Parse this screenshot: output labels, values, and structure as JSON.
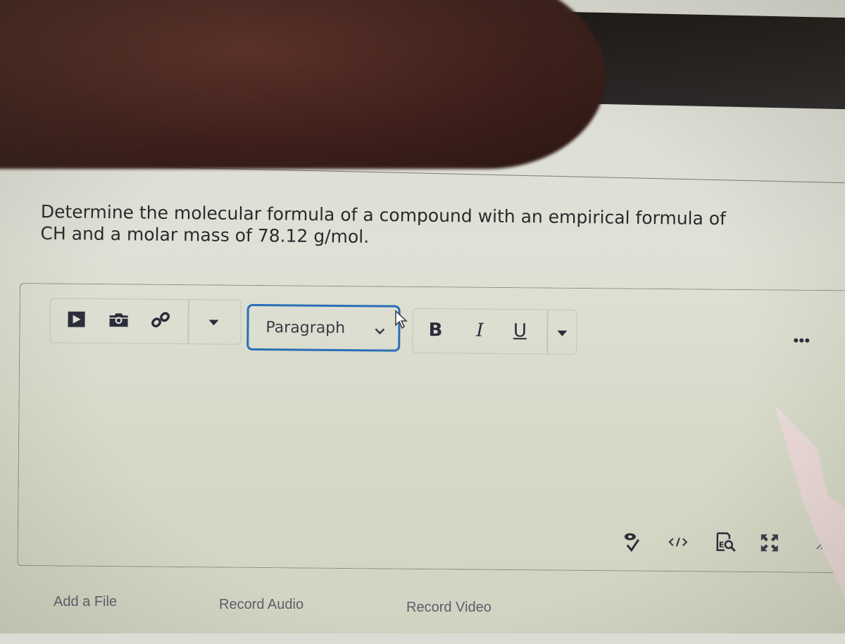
{
  "question": {
    "line1": "Determine the molecular formula of a compound with an empirical formula of",
    "line2": "CH and a molar mass of 78.12 g/mol."
  },
  "editor": {
    "insert_group": {
      "icons": [
        "insert-media-icon",
        "insert-image-icon",
        "insert-link-icon"
      ],
      "dropdown_icon": "caret-down-icon"
    },
    "format_select": {
      "selected": "Paragraph",
      "chevron_icon": "chevron-down-icon"
    },
    "text_style": {
      "bold_label": "B",
      "italic_label": "I",
      "underline_label": "U",
      "dropdown_icon": "caret-down-icon"
    },
    "more_actions_icon": "ellipsis-icon",
    "bottom_icons": [
      "accessibility-checker-icon",
      "source-code-icon",
      "equation-editor-icon",
      "fullscreen-icon",
      "resize-handle-icon"
    ],
    "accent_color": "#2a6fb5"
  },
  "attachments": {
    "add_file": "Add a File",
    "record_audio": "Record Audio",
    "record_video": "Record Video"
  }
}
